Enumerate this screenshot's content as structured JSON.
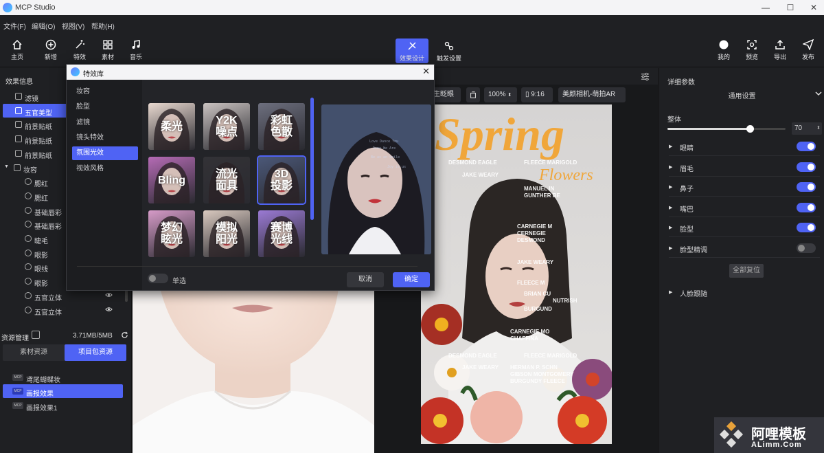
{
  "app": {
    "title": "MCP Studio"
  },
  "menu": [
    "文件(F)",
    "编辑(O)",
    "视图(V)",
    "帮助(H)"
  ],
  "toolbar": {
    "left": [
      {
        "label": "主页",
        "icon": "home-icon"
      },
      {
        "label": "新增",
        "icon": "plus-circle-icon"
      },
      {
        "label": "特效",
        "icon": "magic-wand-icon"
      },
      {
        "label": "素材",
        "icon": "grid-icon"
      },
      {
        "label": "音乐",
        "icon": "music-note-icon"
      }
    ],
    "center": [
      {
        "label": "效果设计",
        "icon": "design-icon",
        "active": true
      },
      {
        "label": "触发设置",
        "icon": "trigger-icon",
        "active": false
      }
    ],
    "right": [
      {
        "label": "我的",
        "icon": "user-icon"
      },
      {
        "label": "预览",
        "icon": "preview-icon"
      },
      {
        "label": "导出",
        "icon": "export-icon"
      },
      {
        "label": "发布",
        "icon": "send-icon"
      }
    ]
  },
  "left_panel": {
    "title": "效果信息",
    "tree": [
      {
        "label": "滤镜",
        "indent": 1,
        "icon": "layers-icon"
      },
      {
        "label": "五官美型",
        "indent": 1,
        "icon": "face-icon",
        "selected": true
      },
      {
        "label": "前景贴纸",
        "indent": 1,
        "icon": "sticker-icon"
      },
      {
        "label": "前景贴纸",
        "indent": 1,
        "icon": "sticker-icon"
      },
      {
        "label": "前景贴纸",
        "indent": 1,
        "icon": "sticker-icon"
      },
      {
        "label": "妆容",
        "indent": 0,
        "icon": "makeup-icon",
        "expanded": true
      },
      {
        "label": "腮红",
        "indent": 2,
        "icon": "brush-icon"
      },
      {
        "label": "腮红",
        "indent": 2,
        "icon": "brush-icon"
      },
      {
        "label": "基础唇彩",
        "indent": 2,
        "icon": "brush-icon"
      },
      {
        "label": "基础唇彩",
        "indent": 2,
        "icon": "brush-icon"
      },
      {
        "label": "睫毛",
        "indent": 2,
        "icon": "brush-icon"
      },
      {
        "label": "眼影",
        "indent": 2,
        "icon": "brush-icon"
      },
      {
        "label": "眼线",
        "indent": 2,
        "icon": "brush-icon"
      },
      {
        "label": "眼影",
        "indent": 2,
        "icon": "brush-icon"
      },
      {
        "label": "五官立体",
        "indent": 2,
        "icon": "brush-icon",
        "eye": true
      },
      {
        "label": "五官立体",
        "indent": 2,
        "icon": "brush-icon",
        "eye": true
      }
    ],
    "resources": {
      "title": "资源管理",
      "usage": "3.71MB/5MB",
      "tabs": [
        {
          "label": "素材资源",
          "active": false
        },
        {
          "label": "项目包资源",
          "active": true
        }
      ],
      "items": [
        {
          "label": "鸢尾蝴蝶妆",
          "selected": false
        },
        {
          "label": "画报效果",
          "selected": true
        },
        {
          "label": "画报效果1",
          "selected": false
        }
      ],
      "badge": "MCP"
    }
  },
  "canvas": {
    "controls": [
      {
        "label": "生眨眼"
      },
      {
        "label": "100%"
      },
      {
        "label": "9:16"
      },
      {
        "label": "美颜相机-萌拍AR"
      }
    ],
    "poster": {
      "headline": "Spring",
      "subline": "Flowers",
      "words": [
        "DESMOND EAGLE",
        "FLEECE MARIGOLD",
        "JAKE WEARY",
        "MANUEL IN",
        "GUNTHER BE",
        "CARNEGIE M",
        "CERNEGIE",
        "DESMOND",
        "JAKE WEARY",
        "FLEECE M",
        "BRIAN CU",
        "NUTRISH",
        "BURGUND",
        "CARNEGIE MO",
        "CHAFFINA",
        "DESMOND EAGLE",
        "FLEECE MARIGOLD",
        "JAKE WEARY",
        "HERMAN P. SCHN",
        "GIBSON MONTGOMERY",
        "BURGUNDY FLEECE"
      ]
    }
  },
  "right_panel": {
    "title": "详细参数",
    "section": "通用设置",
    "slider": {
      "label": "整体",
      "value": "70",
      "fraction": 0.7
    },
    "rows": [
      {
        "label": "眼睛",
        "on": true
      },
      {
        "label": "眉毛",
        "on": true
      },
      {
        "label": "鼻子",
        "on": true
      },
      {
        "label": "嘴巴",
        "on": true
      },
      {
        "label": "脸型",
        "on": true
      },
      {
        "label": "脸型精调",
        "on": false
      }
    ],
    "reset_label": "全部复位",
    "face_track": "人脸跟随"
  },
  "modal": {
    "title": "特效库",
    "categories": [
      {
        "label": "妆容",
        "selected": false
      },
      {
        "label": "脸型",
        "selected": false
      },
      {
        "label": "滤镜",
        "selected": false
      },
      {
        "label": "镜头特效",
        "selected": false
      },
      {
        "label": "氛围光效",
        "selected": true
      },
      {
        "label": "视效风格",
        "selected": false
      }
    ],
    "effects": [
      {
        "label": "柔光",
        "bg": "#e8d8cf",
        "fg": "#fff"
      },
      {
        "label": "Y2K\n噪点",
        "bg": "#c9c2c0",
        "fg": "#fff"
      },
      {
        "label": "彩虹\n色散",
        "bg": "#6d6f7e",
        "fg": "#fff"
      },
      {
        "label": "Bling",
        "bg": "#b56bb5",
        "fg": "#fff"
      },
      {
        "label": "流光\n面具",
        "bg": "#333236",
        "fg": "#fff"
      },
      {
        "label": "3D\n投影",
        "bg": "#4b5878",
        "fg": "#fff",
        "selected": true
      },
      {
        "label": "梦幻\n眩光",
        "bg": "#d69bc8",
        "fg": "#fff"
      },
      {
        "label": "模拟\n阳光",
        "bg": "#d9c9bf",
        "fg": "#fff"
      },
      {
        "label": "赛博\n光线",
        "bg": "#9b7ad4",
        "fg": "#fff"
      }
    ],
    "single_label": "单选",
    "cancel_label": "取消",
    "ok_label": "确定"
  },
  "watermark": {
    "text": "阿哩模板",
    "url": "ALimm.Com"
  },
  "colors": {
    "accent": "#4f63f4",
    "bg": "#1f2023",
    "poster_title": "#f0a63a"
  }
}
